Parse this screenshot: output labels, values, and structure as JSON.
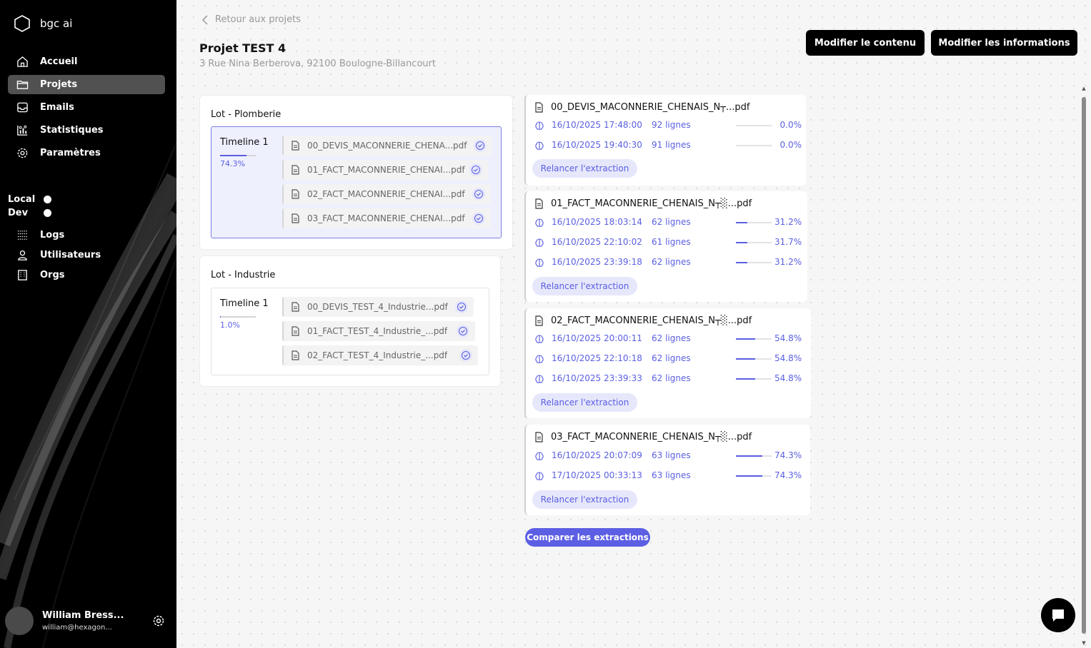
{
  "brand": {
    "name": "bgc ai"
  },
  "nav": {
    "items": [
      {
        "label": "Accueil",
        "icon": "home-icon"
      },
      {
        "label": "Projets",
        "icon": "folder-icon"
      },
      {
        "label": "Emails",
        "icon": "inbox-icon"
      },
      {
        "label": "Statistiques",
        "icon": "stats-icon"
      },
      {
        "label": "Paramètres",
        "icon": "gear-icon"
      }
    ],
    "active": "Projets"
  },
  "env": {
    "local": "Local",
    "dev": "Dev"
  },
  "nav_admin": {
    "items": [
      {
        "label": "Logs",
        "icon": "list-icon"
      },
      {
        "label": "Utilisateurs",
        "icon": "user-icon"
      },
      {
        "label": "Orgs",
        "icon": "building-icon"
      }
    ]
  },
  "user": {
    "name": "William Bress...",
    "email": "william@hexagon..."
  },
  "header": {
    "back_label": "Retour aux projets",
    "title": "Projet TEST 4",
    "address": "3 Rue Nina Berberova, 92100 Boulogne-Billancourt",
    "btn_edit_content": "Modifier le contenu",
    "btn_edit_info": "Modifier les informations"
  },
  "lots": [
    {
      "title": "Lot - Plomberie",
      "timeline": {
        "label": "Timeline 1",
        "progress": 0.743,
        "progress_label": "74.3%"
      },
      "files": [
        "00_DEVIS_MACONNERIE_CHENA...pdf",
        "01_FACT_MACONNERIE_CHENAI...pdf",
        "02_FACT_MACONNERIE_CHENAI...pdf",
        "03_FACT_MACONNERIE_CHENAI...pdf"
      ]
    },
    {
      "title": "Lot - Industrie",
      "timeline": {
        "label": "Timeline 1",
        "progress": 0.01,
        "progress_label": "1.0%"
      },
      "files": [
        "00_DEVIS_TEST_4_Industrie...pdf",
        "01_FACT_TEST_4_Industrie_...pdf",
        "02_FACT_TEST_4_Industrie_...pdf"
      ]
    }
  ],
  "extractions": [
    {
      "file": "00_DEVIS_MACONNERIE_CHENAIS_N┬...pdf",
      "rows": [
        {
          "date": "16/10/2025 17:48:00",
          "lines": "92 lignes",
          "progress": 0.0,
          "pct": "0.0%"
        },
        {
          "date": "16/10/2025 19:40:30",
          "lines": "91 lignes",
          "progress": 0.0,
          "pct": "0.0%"
        }
      ],
      "action": "Relancer l'extraction"
    },
    {
      "file": "01_FACT_MACONNERIE_CHENAIS_N┬░...pdf",
      "rows": [
        {
          "date": "16/10/2025 18:03:14",
          "lines": "62 lignes",
          "progress": 0.312,
          "pct": "31.2%"
        },
        {
          "date": "16/10/2025 22:10:02",
          "lines": "61 lignes",
          "progress": 0.317,
          "pct": "31.7%"
        },
        {
          "date": "16/10/2025 23:39:18",
          "lines": "62 lignes",
          "progress": 0.312,
          "pct": "31.2%"
        }
      ],
      "action": "Relancer l'extraction"
    },
    {
      "file": "02_FACT_MACONNERIE_CHENAIS_N┬░...pdf",
      "rows": [
        {
          "date": "16/10/2025 20:00:11",
          "lines": "62 lignes",
          "progress": 0.548,
          "pct": "54.8%"
        },
        {
          "date": "16/10/2025 22:10:18",
          "lines": "62 lignes",
          "progress": 0.548,
          "pct": "54.8%"
        },
        {
          "date": "16/10/2025 23:39:33",
          "lines": "62 lignes",
          "progress": 0.548,
          "pct": "54.8%"
        }
      ],
      "action": "Relancer l'extraction"
    },
    {
      "file": "03_FACT_MACONNERIE_CHENAIS_N┬░...pdf",
      "rows": [
        {
          "date": "16/10/2025 20:07:09",
          "lines": "63 lignes",
          "progress": 0.743,
          "pct": "74.3%"
        },
        {
          "date": "17/10/2025 00:33:13",
          "lines": "63 lignes",
          "progress": 0.743,
          "pct": "74.3%"
        }
      ],
      "action": "Relancer l'extraction"
    }
  ],
  "compare_label": "Comparer les extractions",
  "colors": {
    "accent": "#5a5fe0",
    "accent_light": "#e6e7fb",
    "sidebar_bg": "#000000",
    "active_nav": "#515151"
  }
}
